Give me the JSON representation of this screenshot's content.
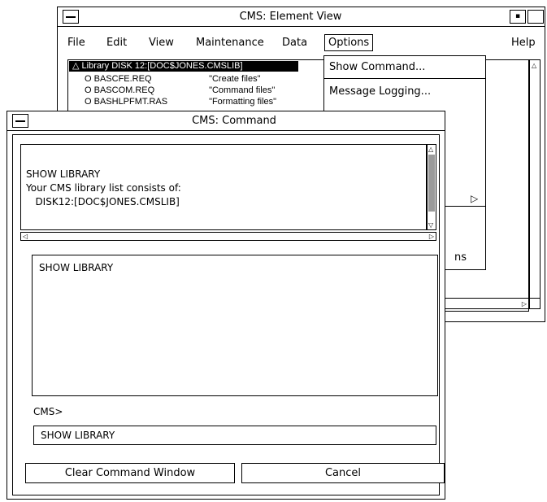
{
  "element_view": {
    "title": "CMS: Element View",
    "menus": {
      "file": "File",
      "edit": "Edit",
      "view": "View",
      "maintenance": "Maintenance",
      "data": "Data",
      "options": "Options",
      "help": "Help"
    },
    "library_row": "△ Library DISK 12:[DOC$JONES.CMSLIB]",
    "elements": [
      {
        "name": "O  BASCFE.REQ",
        "desc": "\"Create files\""
      },
      {
        "name": "O  BASCOM.REQ",
        "desc": "\"Command files\""
      },
      {
        "name": "O  BASHLPFMT.RAS",
        "desc": "\"Formatting files\""
      }
    ]
  },
  "options_menu": {
    "items": [
      {
        "label": "Show Command..."
      },
      {
        "label": "Message Logging..."
      },
      {
        "label": "ns"
      }
    ]
  },
  "command_window": {
    "title": "CMS: Command",
    "output_text": "SHOW LIBRARY\nYour CMS library list consists of:\n   DISK12:[DOC$JONES.CMSLIB]",
    "history_text": "SHOW LIBRARY",
    "prompt": "CMS>",
    "input_value": "SHOW LIBRARY",
    "buttons": {
      "clear": "Clear Command Window",
      "cancel": "Cancel"
    }
  }
}
